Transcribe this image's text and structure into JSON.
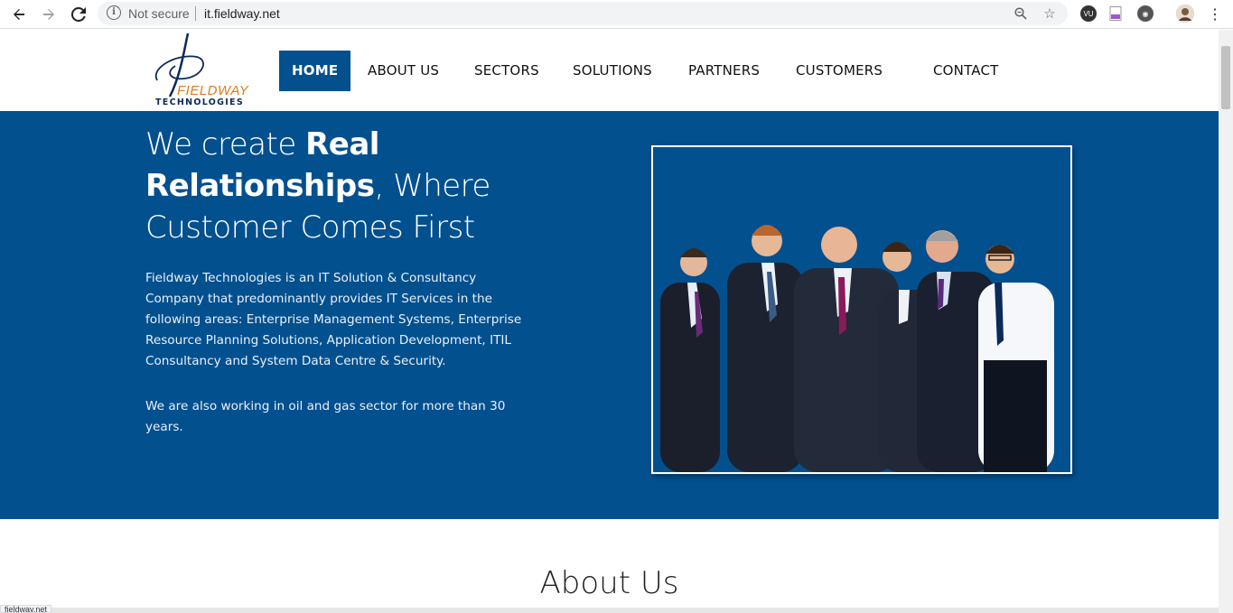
{
  "browser": {
    "security_label": "Not secure",
    "url": "it.fieldway.net",
    "status_url": "fieldway.net",
    "icons": [
      "back-arrow-icon",
      "forward-arrow-icon",
      "reload-icon",
      "info-icon",
      "zoom-icon",
      "star-icon",
      "extension-icons",
      "profile-avatar",
      "menu-kebab-icon"
    ]
  },
  "logo": {
    "line1": "FIELDWAY",
    "line2": "TECHNOLOGIES",
    "colors": {
      "orange": "#e07b1a",
      "navy": "#0a2a5a"
    }
  },
  "nav": {
    "items": [
      {
        "label": "HOME",
        "active": true
      },
      {
        "label": "ABOUT US"
      },
      {
        "label": "SECTORS"
      },
      {
        "label": "SOLUTIONS"
      },
      {
        "label": "PARTNERS"
      },
      {
        "label": "CUSTOMERS"
      },
      {
        "label": "CONTACT"
      }
    ]
  },
  "hero": {
    "title_part1": "We create ",
    "title_bold": "Real Relationships",
    "title_part2": ", Where Customer Comes First",
    "paragraph1": "Fieldway Technologies is an IT Solution & Consultancy Company that predominantly provides IT Services in the following areas: Enterprise Management Systems, Enterprise Resource Planning Solutions, Application Development, ITIL Consultancy and System Data Centre & Security.",
    "paragraph2": "We are also working in oil and gas sector for more than 30 years.",
    "image": "team-photo",
    "background_color": "#03508f"
  },
  "about": {
    "title": "About Us"
  }
}
